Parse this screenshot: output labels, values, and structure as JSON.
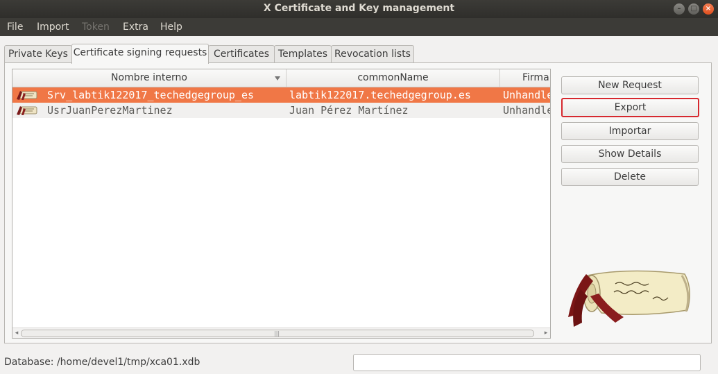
{
  "window": {
    "title": "X Certificate and Key management"
  },
  "window_controls": {
    "minimize": "–",
    "maximize": "□",
    "close": "×"
  },
  "menu": {
    "file": "File",
    "import": "Import",
    "token": "Token",
    "extra": "Extra",
    "help": "Help"
  },
  "tabs": [
    "Private Keys",
    "Certificate signing requests",
    "Certificates",
    "Templates",
    "Revocation lists"
  ],
  "active_tab": "Certificate signing requests",
  "table": {
    "columns": [
      "Nombre interno",
      "commonName",
      "Firma"
    ],
    "rows": [
      {
        "name": "Srv_labtik122017_techedgegroup_es",
        "commonName": "labtik122017.techedgegroup.es",
        "signature": "Unhandled"
      },
      {
        "name": "UsrJuanPerezMartinez",
        "commonName": "Juan Pérez Martínez",
        "signature": "Unhandled"
      }
    ],
    "scroll_grip": "|||"
  },
  "buttons": {
    "new_request": "New Request",
    "export": "Export",
    "import": "Importar",
    "show_details": "Show Details",
    "delete": "Delete"
  },
  "status": {
    "database": "Database: /home/devel1/tmp/xca01.xdb"
  },
  "colors": {
    "selection": "#f07746",
    "focus_border": "#d6282e",
    "titlebar": "#3c3b37"
  }
}
